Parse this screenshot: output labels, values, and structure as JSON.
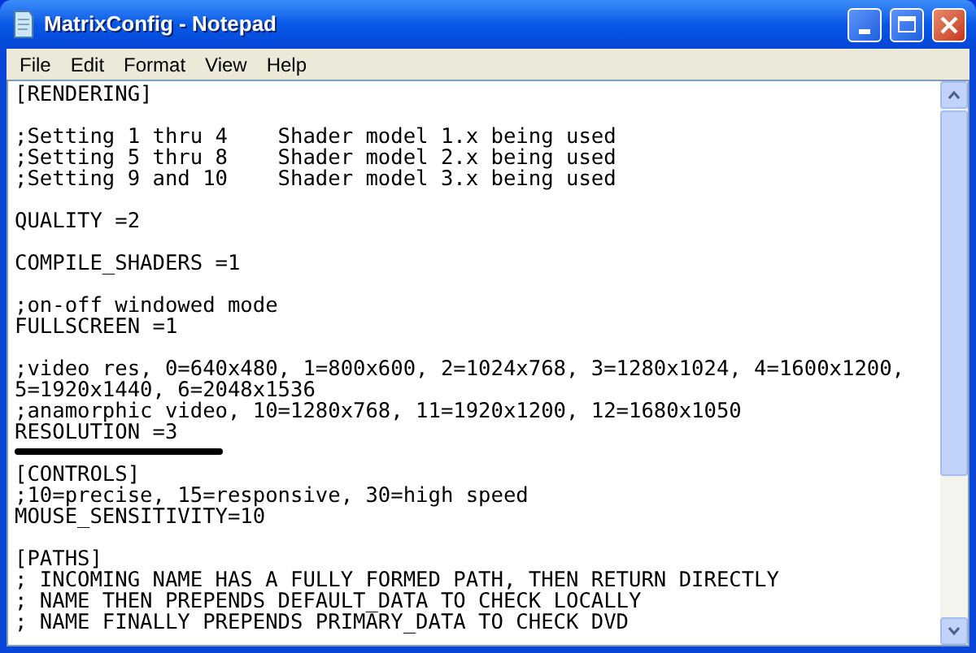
{
  "window": {
    "title": "MatrixConfig - Notepad"
  },
  "menu": [
    "File",
    "Edit",
    "Format",
    "View",
    "Help"
  ],
  "paragraphs": [
    [
      {
        "text": "[RENDERING]",
        "underlined": false
      }
    ],
    [
      {
        "text": ";Setting 1 thru 4    Shader model 1.x being used",
        "underlined": false
      },
      {
        "text": ";Setting 5 thru 8    Shader model 2.x being used",
        "underlined": false
      },
      {
        "text": ";Setting 9 and 10    Shader model 3.x being used",
        "underlined": false
      }
    ],
    [
      {
        "text": "QUALITY =2",
        "underlined": false
      }
    ],
    [
      {
        "text": "COMPILE_SHADERS =1",
        "underlined": false
      }
    ],
    [
      {
        "text": ";on-off windowed mode",
        "underlined": false
      },
      {
        "text": "FULLSCREEN =1",
        "underlined": false
      }
    ],
    [
      {
        "text": ";video res, 0=640x480, 1=800x600, 2=1024x768, 3=1280x1024, 4=1600x1200,",
        "underlined": false
      },
      {
        "text": "5=1920x1440, 6=2048x1536",
        "underlined": false
      },
      {
        "text": ";anamorphic video, 10=1280x768, 11=1920x1200, 12=1680x1050",
        "underlined": false
      },
      {
        "text": "RESOLUTION =3",
        "underlined": true
      }
    ],
    [
      {
        "text": "[CONTROLS]",
        "underlined": false
      },
      {
        "text": ";10=precise, 15=responsive, 30=high speed",
        "underlined": false
      },
      {
        "text": "MOUSE_SENSITIVITY=10",
        "underlined": false
      }
    ],
    [
      {
        "text": "[PATHS]",
        "underlined": false
      },
      {
        "text": "; INCOMING NAME HAS A FULLY FORMED PATH, THEN RETURN DIRECTLY",
        "underlined": false
      },
      {
        "text": "; NAME THEN PREPENDS DEFAULT_DATA TO CHECK LOCALLY",
        "underlined": false
      },
      {
        "text": "; NAME FINALLY PREPENDS PRIMARY_DATA TO CHECK DVD",
        "underlined": false
      }
    ]
  ]
}
